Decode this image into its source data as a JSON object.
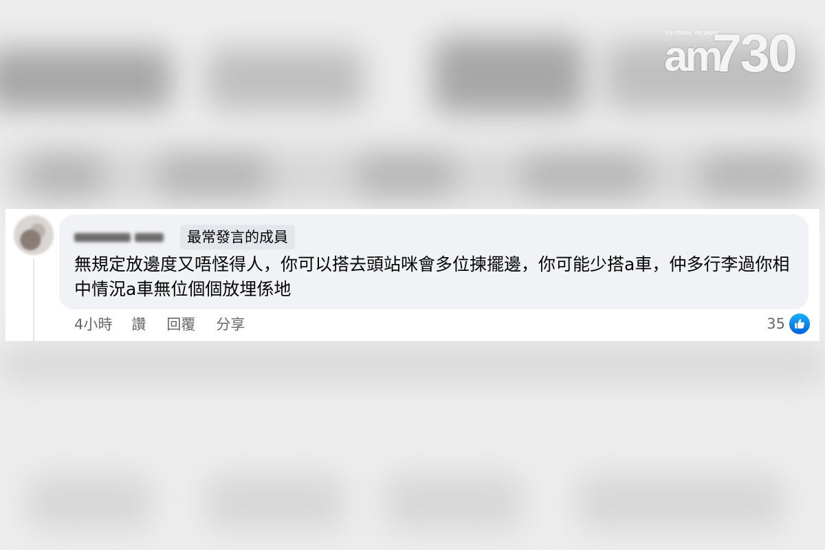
{
  "logo": {
    "tagline": "my choice. my paper",
    "brand_am": "am",
    "brand_num": "730"
  },
  "comment": {
    "badge": "最常發言的成員",
    "text": "無規定放邊度又唔怪得人，你可以搭去頭站咪會多位揀擺邊，你可能少搭a車，仲多行李過你相中情況a車無位個個放埋係地",
    "time": "4小時",
    "like_label": "讚",
    "reply_label": "回覆",
    "share_label": "分享",
    "reaction_count": "35",
    "reaction_icon": "thumbs-up-icon"
  },
  "colors": {
    "bubble": "#f0f2f5",
    "badge": "#e4e6eb",
    "secondary_text": "#65676b",
    "like_blue": "#0866ff"
  }
}
